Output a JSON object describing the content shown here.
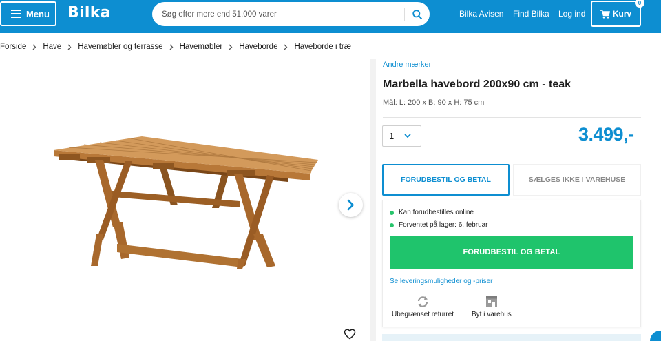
{
  "header": {
    "menu_label": "Menu",
    "logo_text": "Bilka",
    "search_placeholder": "Søg efter mere end 51.000 varer",
    "nav": [
      "Bilka Avisen",
      "Find Bilka",
      "Log ind"
    ],
    "cart_label": "Kurv",
    "cart_count": "0",
    "brand_color": "#0d8ed1"
  },
  "breadcrumb": [
    "Forside",
    "Have",
    "Havemøbler og terrasse",
    "Havemøbler",
    "Haveborde",
    "Haveborde i træ"
  ],
  "product": {
    "brand_link": "Andre mærker",
    "title": "Marbella havebord 200x90 cm - teak",
    "dimensions": "Mål: L: 200 x B: 90 x H: 75 cm",
    "quantity": "1",
    "price": "3.499,-"
  },
  "purchase": {
    "tab_active": "FORUDBESTIL OG BETAL",
    "tab_inactive": "SÆLGES IKKE I VAREHUSE",
    "status": [
      "Kan forudbestilles online",
      "Forventet på lager: 6. februar"
    ],
    "status_color": "#27c46b",
    "order_button": "FORUDBESTIL OG BETAL",
    "order_button_color": "#1fc46c",
    "delivery_link": "Se leveringsmuligheder og -priser",
    "features": [
      {
        "label": "Ubegrænset returret",
        "icon": "return-arrows-icon"
      },
      {
        "label": "Byt i varehus",
        "icon": "store-icon"
      }
    ]
  }
}
